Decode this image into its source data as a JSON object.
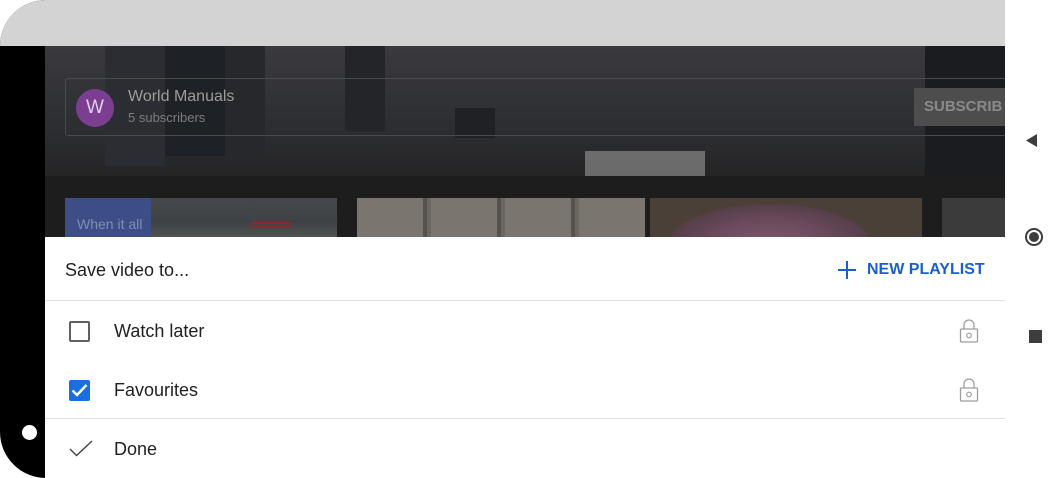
{
  "channel": {
    "avatar_letter": "W",
    "name": "World Manuals",
    "subscribers": "5 subscribers",
    "subscribe_label": "SUBSCRIB"
  },
  "thumbnails": [
    {
      "label": "When it all"
    }
  ],
  "sheet": {
    "title": "Save video to...",
    "new_playlist_label": "NEW PLAYLIST",
    "playlists": [
      {
        "label": "Watch later",
        "checked": false,
        "private": true
      },
      {
        "label": "Favourites",
        "checked": true,
        "private": true
      }
    ],
    "done_label": "Done"
  },
  "colors": {
    "accent": "#1a5fcf",
    "checkbox_checked": "#1a6fe0",
    "status_bar": "#d3d3d3",
    "avatar": "#7b3e91"
  },
  "icons": {
    "new_playlist": "plus-icon",
    "private": "lock-icon",
    "done": "check-icon",
    "nav_back": "back-triangle-icon",
    "nav_home": "home-circle-icon",
    "nav_recents": "recents-square-icon"
  }
}
